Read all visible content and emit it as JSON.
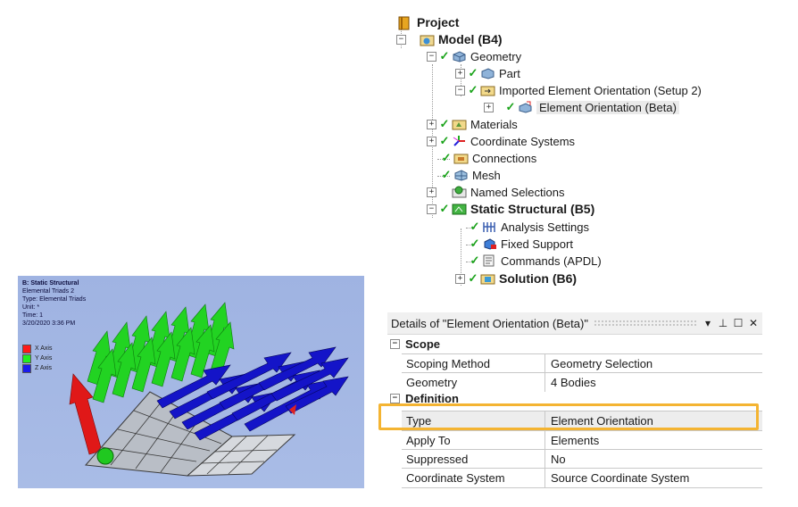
{
  "tree": {
    "project": "Project",
    "model": "Model (B4)",
    "geometry": "Geometry",
    "part": "Part",
    "imported_eo": "Imported Element Orientation (Setup 2)",
    "element_orientation": "Element Orientation (Beta)",
    "materials": "Materials",
    "coordinate_systems": "Coordinate Systems",
    "connections": "Connections",
    "mesh": "Mesh",
    "named_selections": "Named Selections",
    "static_structural": "Static Structural (B5)",
    "analysis_settings": "Analysis Settings",
    "fixed_support": "Fixed Support",
    "commands": "Commands (APDL)",
    "solution": "Solution (B6)"
  },
  "details": {
    "title": "Details of \"Element Orientation (Beta)\"",
    "scope_header": "Scope",
    "definition_header": "Definition",
    "rows": [
      {
        "key": "Scoping Method",
        "value": "Geometry Selection"
      },
      {
        "key": "Geometry",
        "value": "4 Bodies"
      },
      {
        "key": "Type",
        "value": "Element Orientation"
      },
      {
        "key": "Apply To",
        "value": "Elements"
      },
      {
        "key": "Suppressed",
        "value": "No"
      },
      {
        "key": "Coordinate System",
        "value": "Source Coordinate System"
      }
    ]
  },
  "viewport": {
    "title": "B: Static Structural",
    "line1": "Elemental Triads 2",
    "line2": "Type: Elemental Triads",
    "line3": "Unit: *",
    "line4": "Time: 1",
    "line5": "3/20/2020 3:36 PM",
    "legend": [
      {
        "label": "X Axis",
        "color": "#ff1a1a"
      },
      {
        "label": "Y Axis",
        "color": "#22ee22"
      },
      {
        "label": "Z Axis",
        "color": "#1a1aee"
      }
    ]
  },
  "colors": {
    "highlight": "#f4b432",
    "check": "#1aa31a"
  }
}
